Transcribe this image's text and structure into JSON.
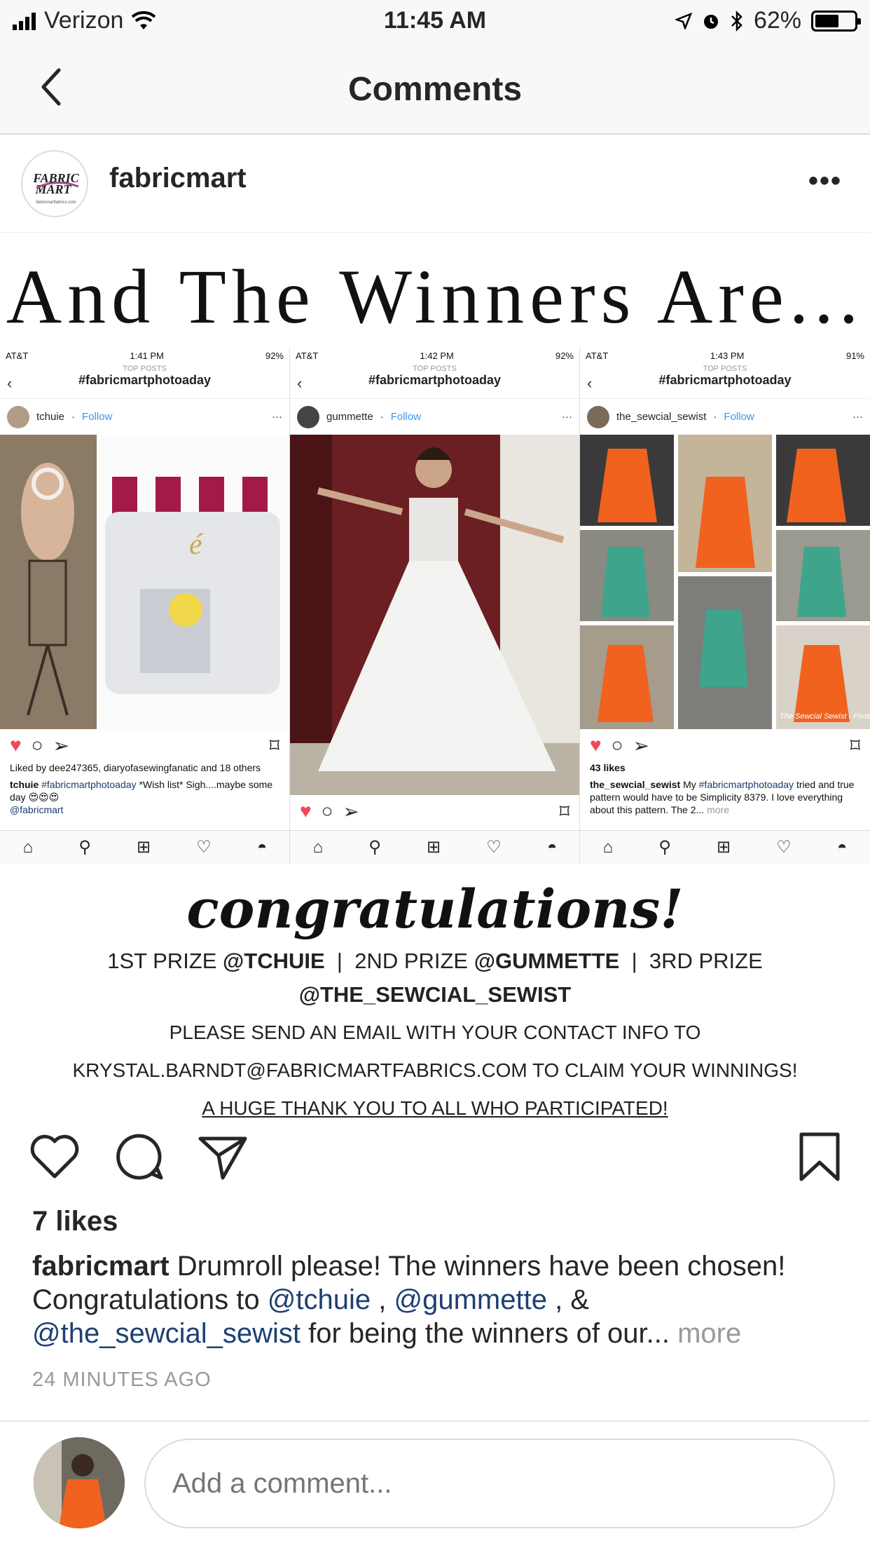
{
  "status": {
    "carrier": "Verizon",
    "time": "11:45 AM",
    "battery": "62%",
    "battery_level": 0.62
  },
  "nav": {
    "title": "Comments",
    "back_icon": "chevron-left-icon"
  },
  "post": {
    "username": "fabricmart",
    "avatar_text": "FABRIC MART",
    "avatar_subtext": "fabricmartfabrics.com",
    "more_label": "•••",
    "image": {
      "headline": "And The Winners Are...",
      "panels": [
        {
          "carrier": "AT&T",
          "time": "1:41 PM",
          "battery": "92%",
          "top": "TOP POSTS",
          "tag": "#fabricmartphotoaday",
          "user": "tchuie",
          "follow": "Follow",
          "likes": "Liked by dee247365, diaryofasewingfanatic and 18 others",
          "cap_user": "tchuie",
          "cap_tag": "#fabricmartphotoaday",
          "cap_text": "*Wish list* Sigh....maybe some day 😍😍😍",
          "cap_more": "@fabricmart"
        },
        {
          "carrier": "AT&T",
          "time": "1:42 PM",
          "battery": "92%",
          "top": "TOP POSTS",
          "tag": "#fabricmartphotoaday",
          "user": "gummette",
          "follow": "Follow"
        },
        {
          "carrier": "AT&T",
          "time": "1:43 PM",
          "battery": "91%",
          "top": "TOP POSTS",
          "tag": "#fabricmartphotoaday",
          "user": "the_sewcial_sewist",
          "follow": "Follow",
          "likes": "43 likes",
          "cap_user": "the_sewcial_sewist",
          "cap_pre": "My",
          "cap_tag": "#fabricmartphotoaday",
          "cap_text": "tried and true pattern would have to be Simplicity 8379. I love everything about this pattern. The 2...",
          "cap_more": "more",
          "watermark": "The Sewcial Sewist - PhotoGrid"
        }
      ],
      "congrats_title": "congratulations!",
      "prize_1_label": "1ST PRIZE",
      "prize_1_user": "@TCHUIE",
      "prize_2_label": "2ND PRIZE",
      "prize_2_user": "@GUMMETTE",
      "prize_3_label": "3RD PRIZE",
      "prize_3_user": "@THE_SEWCIAL_SEWIST",
      "line_2": "PLEASE SEND AN EMAIL WITH YOUR CONTACT INFO TO",
      "line_3": "KRYSTAL.BARNDT@FABRICMARTFABRICS.COM TO CLAIM YOUR WINNINGS!",
      "line_4": "A HUGE THANK YOU TO ALL WHO PARTICIPATED!"
    },
    "likes": "7 likes",
    "caption": {
      "user": "fabricmart",
      "text_1": "Drumroll please! The winners have been chosen! Congratulations to",
      "mention_1": "@tchuie",
      "sep_1": ",",
      "mention_2": "@gummette",
      "sep_2": ", &",
      "mention_3": "@the_sewcial_sewist",
      "text_2": "for being the winners of our...",
      "more": "more"
    },
    "timestamp": "24 MINUTES AGO"
  },
  "comment_input": {
    "placeholder": "Add a comment..."
  }
}
